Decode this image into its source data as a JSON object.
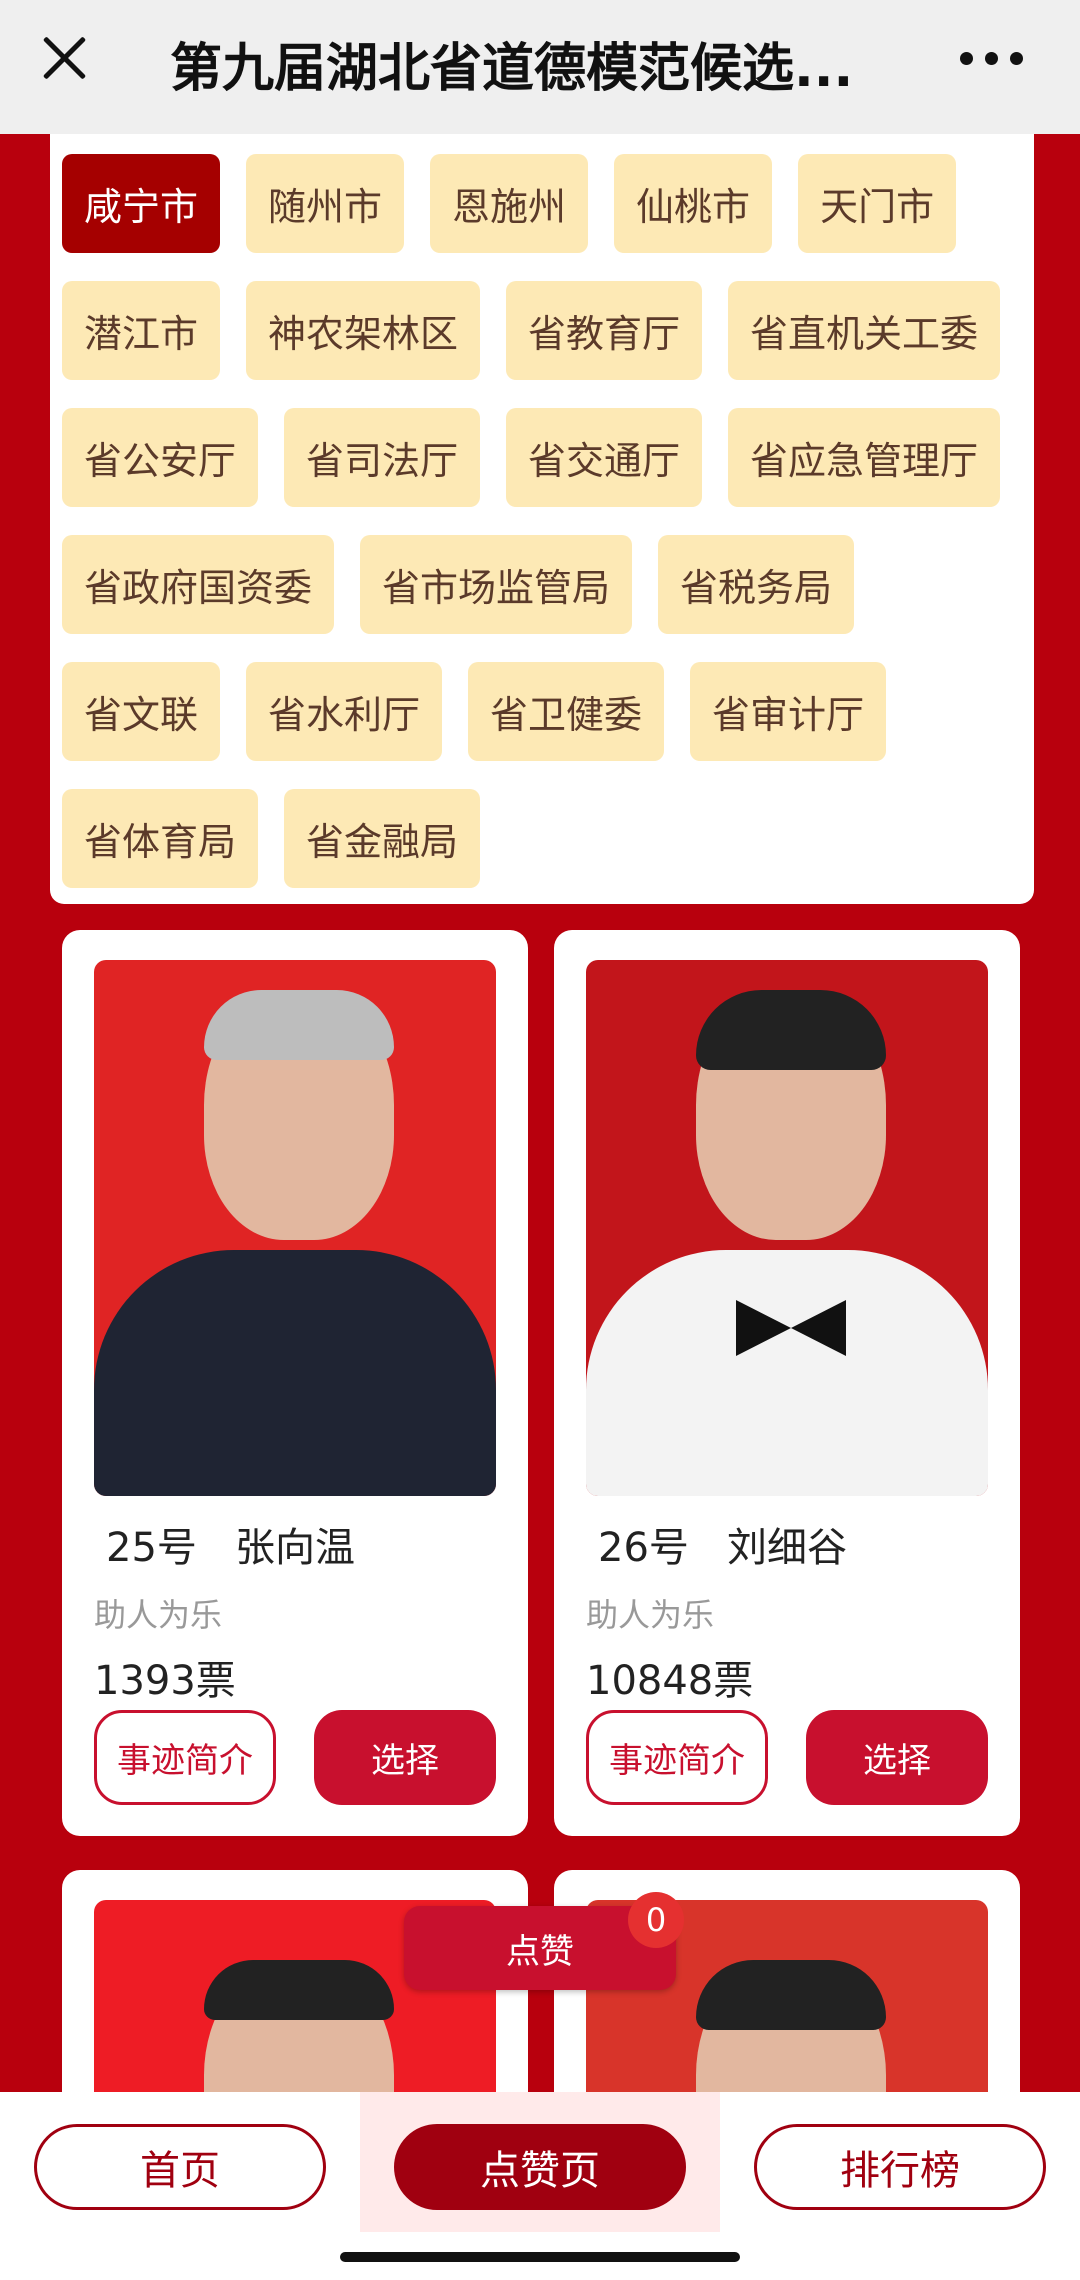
{
  "header": {
    "title": "第九届湖北省道德模范候选..."
  },
  "regions": [
    {
      "label": "咸宁市",
      "active": true
    },
    {
      "label": "随州市"
    },
    {
      "label": "恩施州"
    },
    {
      "label": "仙桃市"
    },
    {
      "label": "天门市"
    },
    {
      "label": "潜江市"
    },
    {
      "label": "神农架林区"
    },
    {
      "label": "省教育厅"
    },
    {
      "label": "省直机关工委"
    },
    {
      "label": "省公安厅"
    },
    {
      "label": "省司法厅"
    },
    {
      "label": "省交通厅"
    },
    {
      "label": "省应急管理厅"
    },
    {
      "label": "省政府国资委"
    },
    {
      "label": "省市场监管局"
    },
    {
      "label": "省税务局"
    },
    {
      "label": "省文联"
    },
    {
      "label": "省水利厅"
    },
    {
      "label": "省卫健委"
    },
    {
      "label": "省审计厅"
    },
    {
      "label": "省体育局"
    },
    {
      "label": "省金融局"
    }
  ],
  "candidates": [
    {
      "name": "25号   张向温",
      "category": "助人为乐",
      "votes": "1393票",
      "story_label": "事迹简介",
      "select_label": "选择"
    },
    {
      "name": "26号   刘细谷",
      "category": "助人为乐",
      "votes": "10848票",
      "story_label": "事迹简介",
      "select_label": "选择"
    }
  ],
  "like_button": {
    "label": "点赞",
    "count": "0"
  },
  "bottom_nav": [
    {
      "label": "首页"
    },
    {
      "label": "点赞页",
      "active": true
    },
    {
      "label": "排行榜"
    }
  ]
}
